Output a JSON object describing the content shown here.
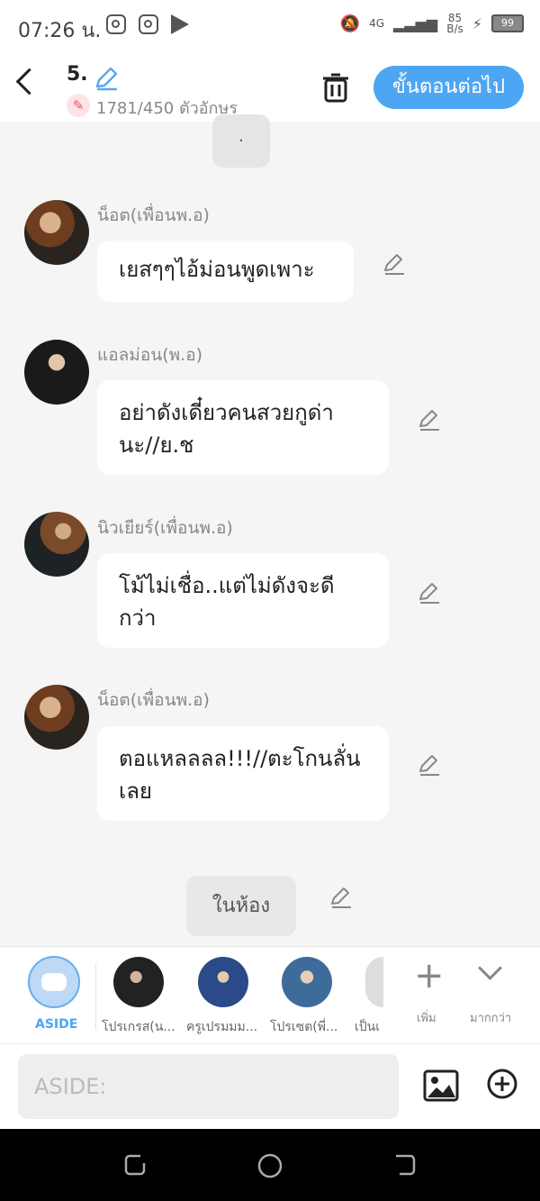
{
  "status_bar": {
    "time": "07:26 น.",
    "network": "4G",
    "speed": "85",
    "speed_unit": "B/s",
    "battery": "99"
  },
  "header": {
    "episode_title": "5.",
    "char_count": "1781/450 ตัวอักษร",
    "next_button": "ขั้นตอนต่อไป"
  },
  "chat": {
    "top_tab_text": ".",
    "messages": [
      {
        "speaker": "น็อต(เพื่อนพ.อ)",
        "text": "เยสๆๆไอ้ม่อนพูดเพาะ"
      },
      {
        "speaker": "แอลม่อน(พ.อ)",
        "text": "อย่าดังเดี๋ยวคนสวยกูด่า นะ//ย.ช"
      },
      {
        "speaker": "นิวเยียร์(เพื่อนพ.อ)",
        "text": "โม้ไม่เชื่อ..แต่ไม่ดังจะดี กว่า"
      },
      {
        "speaker": "น็อต(เพื่อนพ.อ)",
        "text": "ตอแหลลลล!!!//ตะโกนลั่น เลย"
      }
    ],
    "scene_label": "ในห้อง"
  },
  "character_tray": {
    "aside_label": "ASIDE",
    "characters": [
      {
        "label": "โปรเกรส(น..."
      },
      {
        "label": "ครูเปรมมม..."
      },
      {
        "label": "โปรเซต(พี่..."
      },
      {
        "label": "เป็นเ"
      }
    ],
    "add_label": "เพิ่ม",
    "more_label": "มากกว่า"
  },
  "input": {
    "placeholder": "ASIDE:"
  },
  "colors": {
    "accent": "#4da6f3",
    "count_badge": "#ea4d6d"
  }
}
